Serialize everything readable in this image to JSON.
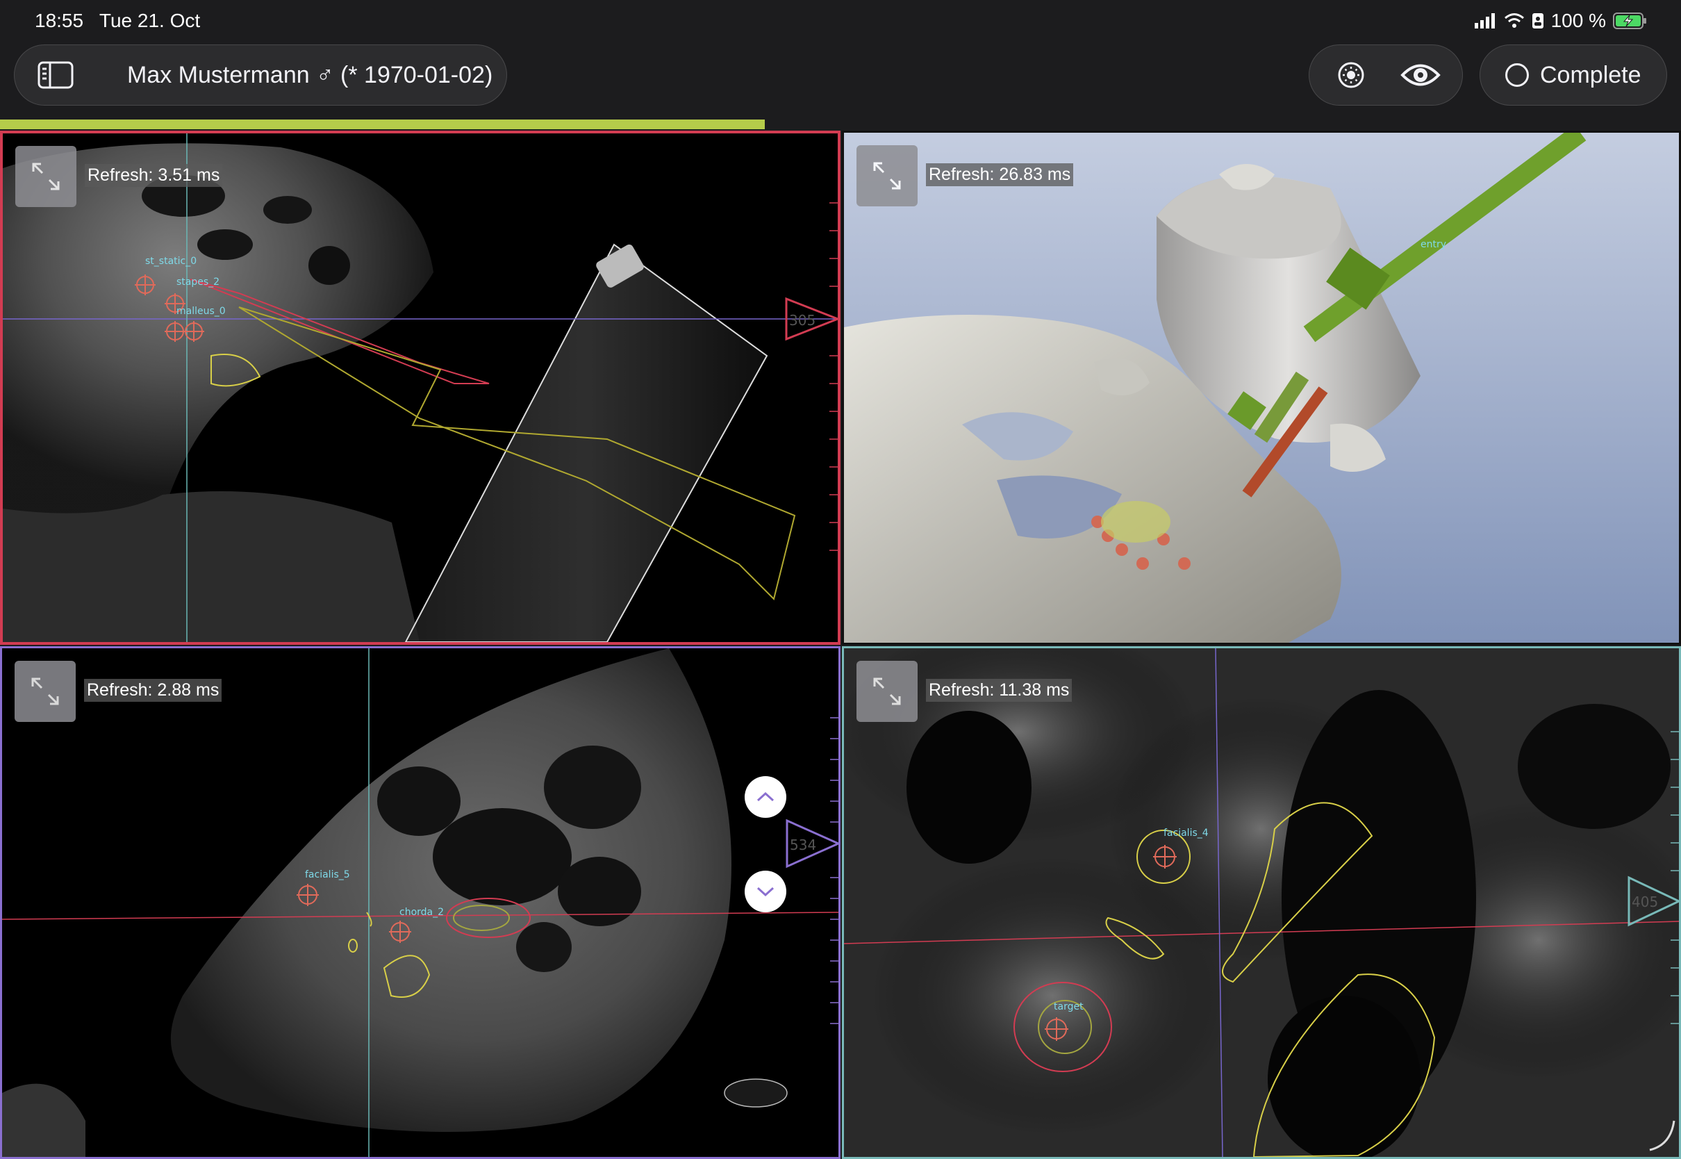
{
  "status": {
    "time": "18:55",
    "date": "Tue 21. Oct",
    "battery": "100 %",
    "icons": [
      "signal-icon",
      "wifi-icon",
      "lock-icon",
      "battery-charging-icon"
    ]
  },
  "header": {
    "patient": "Max Mustermann ♂ (* 1970-01-02)",
    "complete_label": "Complete",
    "progress": 0.455,
    "progress_color": "#b5cc4a"
  },
  "viewports": {
    "top_left": {
      "refresh": "Refresh: 3.51 ms",
      "border_color": "#d23c52",
      "labels": [
        "st_static_0",
        "stapes_2",
        "malleus_0"
      ],
      "slice_label": "305"
    },
    "top_right": {
      "refresh": "Refresh: 26.83 ms",
      "labels": [
        "entry"
      ]
    },
    "bottom_left": {
      "refresh": "Refresh: 2.88 ms",
      "border_color": "#8a6fd0",
      "labels": [
        "facialis_5",
        "chorda_2"
      ],
      "slice_label": "534"
    },
    "bottom_right": {
      "refresh": "Refresh: 11.38 ms",
      "border_color": "#78b9b8",
      "labels": [
        "facialis_4",
        "target"
      ],
      "slice_label": "405"
    }
  }
}
